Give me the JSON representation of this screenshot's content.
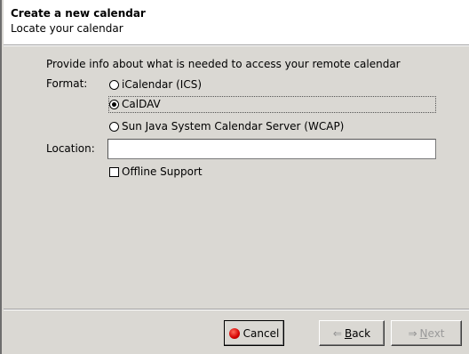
{
  "header": {
    "title": "Create a new calendar",
    "subtitle": "Locate your calendar"
  },
  "form": {
    "instruction": "Provide info about what is needed to access your remote calendar",
    "format_label": "Format:",
    "formats": [
      {
        "label": "iCalendar (ICS)",
        "selected": false
      },
      {
        "label": "CalDAV",
        "selected": true
      },
      {
        "label": "Sun Java System Calendar Server (WCAP)",
        "selected": false
      }
    ],
    "location_label": "Location:",
    "location_value": "",
    "offline_label": "Offline Support",
    "offline_checked": false
  },
  "buttons": {
    "cancel": "Cancel",
    "back_prefix": "",
    "back_mnemonic": "B",
    "back_rest": "ack",
    "next_mnemonic": "N",
    "next_rest": "ext"
  },
  "icons": {
    "cancel": "cancel-stop-icon",
    "back": "back-arrow-icon",
    "next": "next-arrow-icon"
  }
}
